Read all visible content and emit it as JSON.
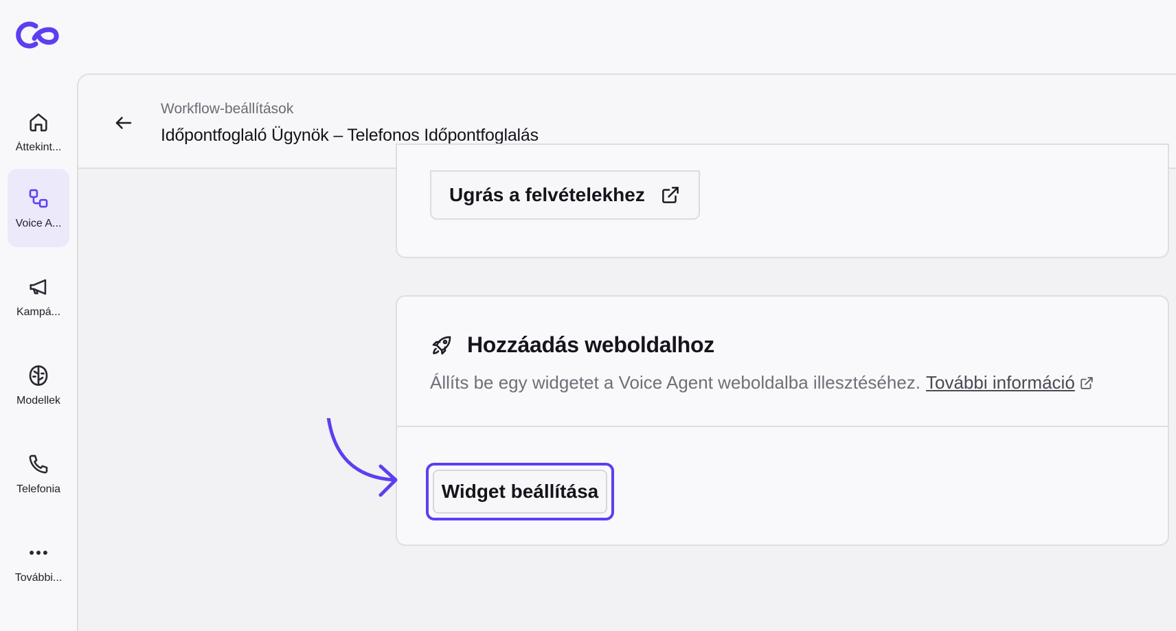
{
  "app": {
    "brand_color": "#5b3ff0"
  },
  "sidebar": {
    "items": [
      {
        "label": "Áttekint...",
        "icon": "home-icon",
        "active": false
      },
      {
        "label": "Voice A...",
        "icon": "workflow-icon",
        "active": true
      },
      {
        "label": "Kampá...",
        "icon": "megaphone-icon",
        "active": false
      },
      {
        "label": "Modellek",
        "icon": "brain-icon",
        "active": false
      },
      {
        "label": "Telefonia",
        "icon": "phone-icon",
        "active": false
      },
      {
        "label": "További...",
        "icon": "more-icon",
        "active": false
      }
    ]
  },
  "header": {
    "breadcrumb": "Workflow-beállítások",
    "title": "Időpontfoglaló Ügynök – Telefonos Időpontfoglalás"
  },
  "recordings": {
    "button_label": "Ugrás a felvételekhez"
  },
  "widget_section": {
    "title": "Hozzáadás weboldalhoz",
    "description": "Állíts be egy widgetet a Voice Agent weboldalba illesztéséhez.",
    "more_info_link": "További információ",
    "setup_button": "Widget beállítása"
  }
}
